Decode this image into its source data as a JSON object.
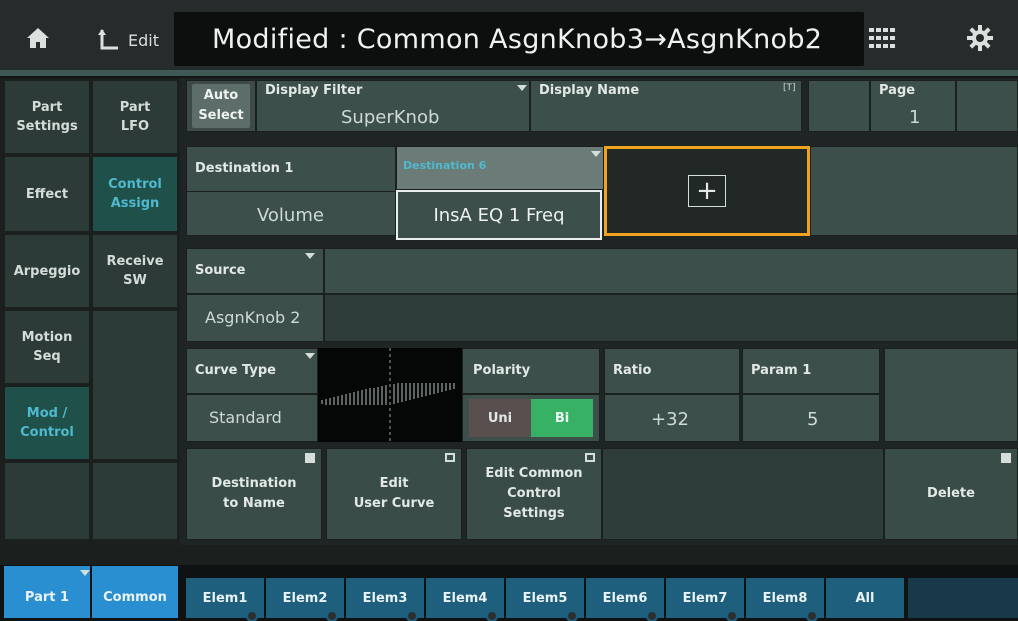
{
  "topbar": {
    "edit_label": "Edit",
    "toast": "Modified : Common AsgnKnob3→AsgnKnob2",
    "icons": [
      "home-icon",
      "back-arrow-icon",
      "grid-icon",
      "gear-icon"
    ]
  },
  "nav_left": [
    {
      "label": "Part\nSettings",
      "active": false
    },
    {
      "label": "Effect",
      "active": false
    },
    {
      "label": "Arpeggio",
      "active": false
    },
    {
      "label": "Motion\nSeq",
      "active": false
    },
    {
      "label": "Mod /\nControl",
      "active": true
    }
  ],
  "nav_right": [
    {
      "label": "Part\nLFO",
      "active": false
    },
    {
      "label": "Control\nAssign",
      "active": true
    },
    {
      "label": "Receive\nSW",
      "active": false
    }
  ],
  "header": {
    "auto_select": "Auto\nSelect",
    "display_filter_label": "Display Filter",
    "display_filter_value": "SuperKnob",
    "display_name_label": "Display Name",
    "display_name_badge": "[T]",
    "page_label": "Page",
    "page_value": "1"
  },
  "destinations": {
    "dest1_label": "Destination 1",
    "dest1_value": "Volume",
    "dest6_label": "Destination 6",
    "dest6_value": "InsA EQ 1 Freq",
    "add_symbol": "+"
  },
  "source": {
    "label": "Source",
    "value": "AsgnKnob 2"
  },
  "curve": {
    "label": "Curve Type",
    "value": "Standard"
  },
  "polarity": {
    "label": "Polarity",
    "uni": "Uni",
    "bi": "Bi",
    "selected": "Bi"
  },
  "ratio": {
    "label": "Ratio",
    "value": "+32"
  },
  "param1": {
    "label": "Param 1",
    "value": "5"
  },
  "buttons": {
    "destination_to_name": "Destination\nto Name",
    "edit_user_curve": "Edit\nUser Curve",
    "edit_common_control": "Edit Common\nControl\nSettings",
    "delete": "Delete"
  },
  "bottom_tabs": {
    "part": "Part 1",
    "common": "Common",
    "elems": [
      "Elem1",
      "Elem2",
      "Elem3",
      "Elem4",
      "Elem5",
      "Elem6",
      "Elem7",
      "Elem8",
      "All"
    ]
  },
  "colors": {
    "accent_orange": "#f0a31e",
    "active_teal": "#4fb9ce",
    "bi_green": "#37b265",
    "tab_blue": "#1d5f7d",
    "part_tab_blue": "#2a8fd0"
  }
}
